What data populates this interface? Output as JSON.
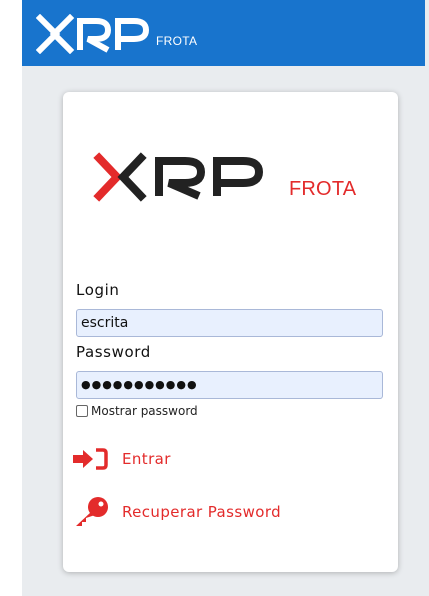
{
  "header": {
    "logo_text": "XRP",
    "logo_sub": "FROTA"
  },
  "brand": {
    "logo_text": "XRP",
    "logo_sub": "FROTA"
  },
  "form": {
    "login_label": "Login",
    "login_value": "escrita",
    "password_label": "Password",
    "password_masked": "●●●●●●●●●●●",
    "show_password_label": "Mostrar password",
    "show_password_checked": false
  },
  "actions": {
    "enter_label": "Entrar",
    "recover_label": "Recuperar Password"
  },
  "icons": {
    "enter": "sign-in-icon",
    "recover": "key-icon"
  },
  "colors": {
    "header_bg": "#1874cd",
    "accent_red": "#e32b2b",
    "input_bg": "#e8f0fe",
    "page_bg": "#e9ecef"
  }
}
